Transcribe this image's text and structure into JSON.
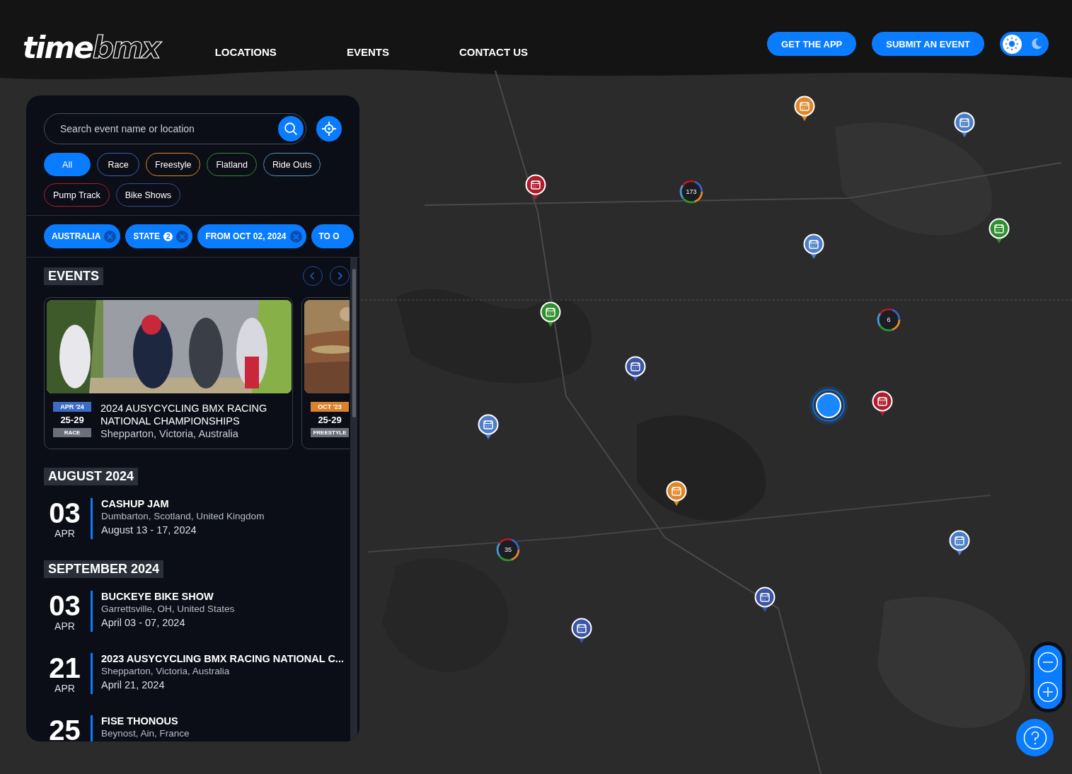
{
  "logo": {
    "solid": "time",
    "outline": "bmx"
  },
  "nav": [
    {
      "label": "LOCATIONS"
    },
    {
      "label": "EVENTS"
    },
    {
      "label": "CONTACT US"
    }
  ],
  "actions": [
    {
      "label": "GET THE APP"
    },
    {
      "label": "SUBMIT AN EVENT"
    }
  ],
  "theme_toggle": [
    {
      "kind": "light",
      "selected": true
    },
    {
      "kind": "dark",
      "selected": false
    }
  ],
  "search": {
    "placeholder": "Search event name or location"
  },
  "categories": [
    {
      "label": "All",
      "selected": true,
      "color": "#0a7cff"
    },
    {
      "label": "Race",
      "selected": false,
      "color": "#3b62b8"
    },
    {
      "label": "Freestyle",
      "selected": false,
      "color": "#e0862a"
    },
    {
      "label": "Flatland",
      "selected": false,
      "color": "#2f8f2f"
    },
    {
      "label": "Ride Outs",
      "selected": false,
      "color": "#4d93c9"
    },
    {
      "label": "Pump Track",
      "selected": false,
      "color": "#b01c2c"
    },
    {
      "label": "Bike Shows",
      "selected": false,
      "color": "#2f4c94"
    }
  ],
  "active_filters": [
    {
      "label": "AUSTRALIA",
      "removable": true
    },
    {
      "label": "STATE",
      "count": "2",
      "removable": true
    },
    {
      "label": "FROM OCT 02, 2024",
      "removable": true
    },
    {
      "label": "TO O",
      "removable": false
    }
  ],
  "events_heading": "EVENTS",
  "featured": [
    {
      "month": "APR '24",
      "color": "#3d6cc4",
      "dates": "25-29",
      "category": "RACE",
      "title": "2024 AUSYCYCLING BMX RACING NATIONAL CHAMPIONSHIPS",
      "location": "Shepparton, Victoria, Australia"
    },
    {
      "month": "OCT '23",
      "color": "#d9822b",
      "dates": "25-29",
      "category": "FREESTYLE"
    }
  ],
  "months": [
    {
      "heading": "AUGUST 2024",
      "events": [
        {
          "day": "03",
          "month": "APR",
          "title": "CASHUP JAM",
          "location": "Dumbarton, Scotland, United Kingdom",
          "dates": "August 13 - 17, 2024"
        }
      ]
    },
    {
      "heading": "SEPTEMBER 2024",
      "events": [
        {
          "day": "03",
          "month": "APR",
          "title": "BUCKEYE BIKE SHOW",
          "location": "Garrettsville, OH, United States",
          "dates": "April 03 - 07, 2024"
        },
        {
          "day": "21",
          "month": "APR",
          "title": "2023 AUSYCYCLING BMX RACING NATIONAL C...",
          "location": "Shepparton, Victoria, Australia",
          "dates": "April 21, 2024"
        },
        {
          "day": "25",
          "title": "FISE THONOUS",
          "location": "Beynost, Ain, France"
        }
      ]
    }
  ],
  "markers": [
    {
      "kind": "event",
      "color": "#e0862a"
    },
    {
      "kind": "event",
      "color": "#4d7fc9"
    },
    {
      "kind": "event",
      "color": "#b01c2c"
    },
    {
      "kind": "cluster",
      "count": "173"
    },
    {
      "kind": "event",
      "color": "#2f8f2f"
    },
    {
      "kind": "event",
      "color": "#4d7fc9"
    },
    {
      "kind": "event",
      "color": "#2f8f2f"
    },
    {
      "kind": "cluster",
      "count": "6"
    },
    {
      "kind": "event",
      "color": "#3b55a8"
    },
    {
      "kind": "location"
    },
    {
      "kind": "event",
      "color": "#b01c2c"
    },
    {
      "kind": "event",
      "color": "#4d7fc9"
    },
    {
      "kind": "event",
      "color": "#e0862a"
    },
    {
      "kind": "event",
      "color": "#4d7fc9"
    },
    {
      "kind": "cluster",
      "count": "35"
    },
    {
      "kind": "event",
      "color": "#3b55a8"
    },
    {
      "kind": "event",
      "color": "#3b55a8"
    }
  ]
}
